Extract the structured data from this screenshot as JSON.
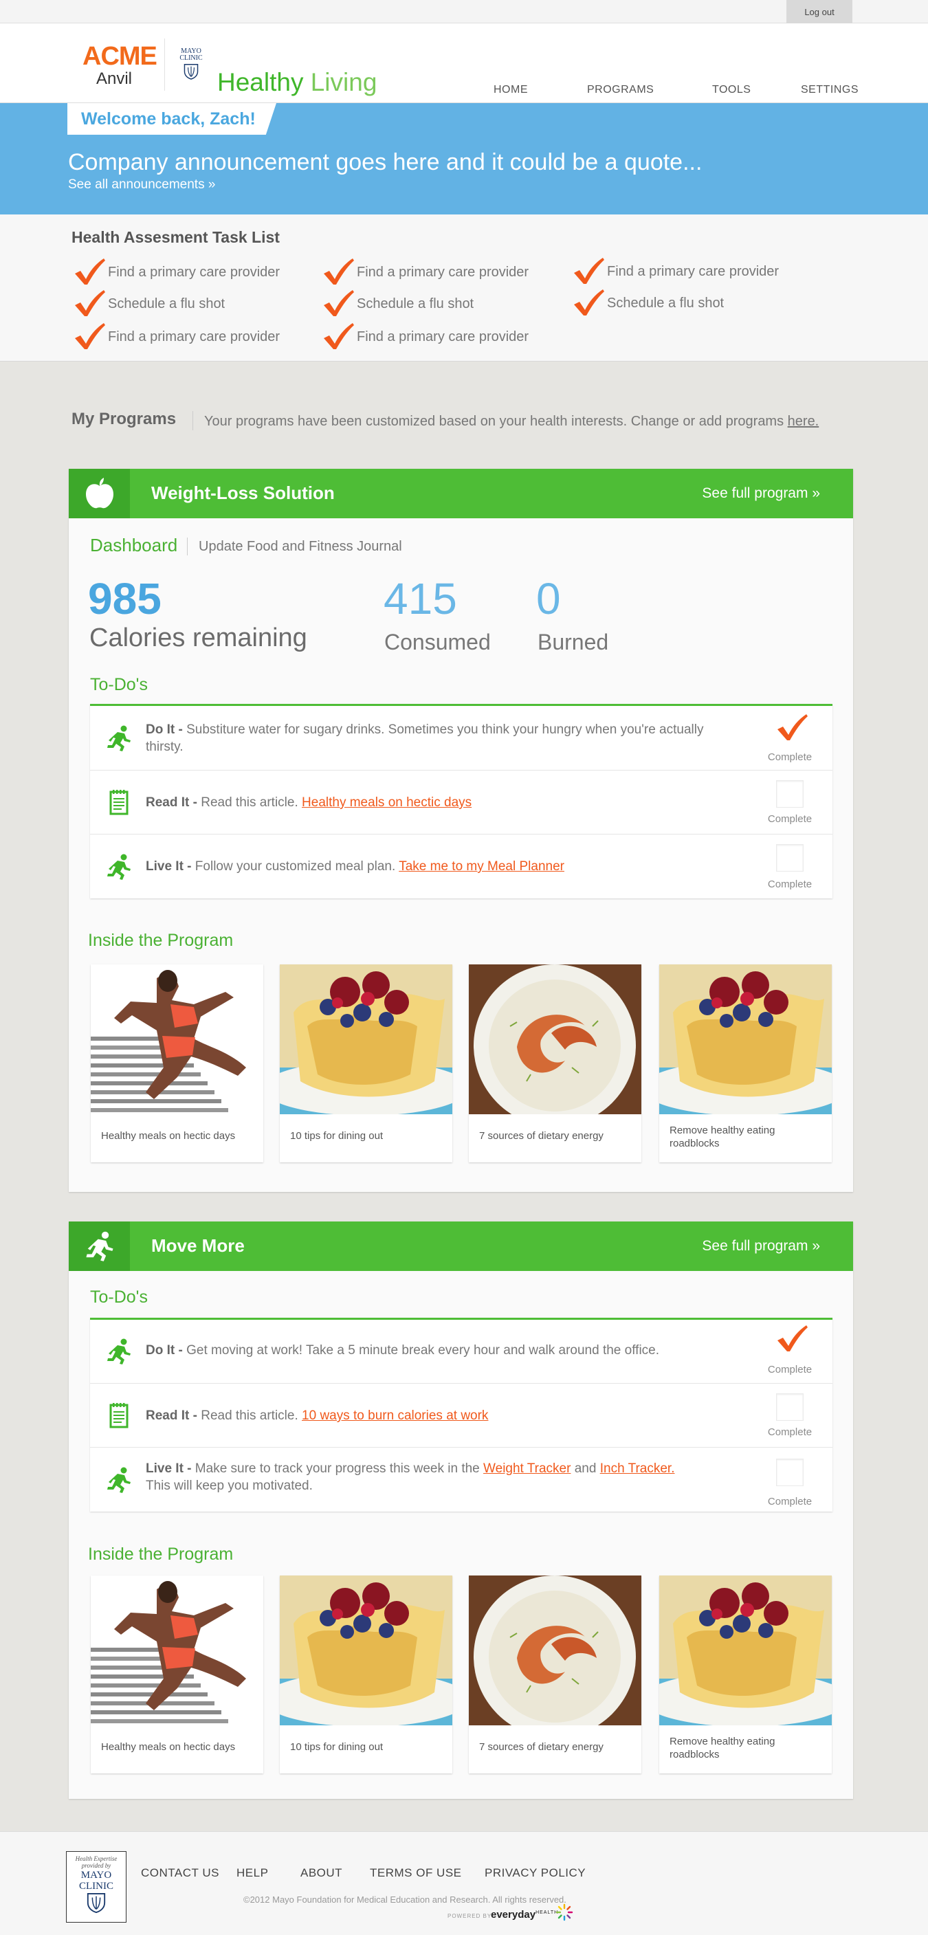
{
  "topbar": {
    "logout_label": "Log out"
  },
  "header": {
    "acme_top": "ACME",
    "acme_bottom": "Anvil",
    "mayo_mini": [
      "MAYO",
      "CLINIC"
    ],
    "brand_part1": "Healthy",
    "brand_part2": "Living",
    "nav": [
      "HOME",
      "PROGRAMS",
      "TOOLS",
      "SETTINGS"
    ]
  },
  "announcement": {
    "welcome": "Welcome back, Zach!",
    "text": "Company announcement goes here and it could be a quote...",
    "link": "See all announcements »"
  },
  "tasks": {
    "title": "Health Assesment Task List",
    "items": [
      "Find a primary care provider",
      "Schedule a flu shot",
      "Find a primary care provider",
      "Find a primary care provider",
      "Schedule a flu shot",
      "Find a primary care provider",
      "Find a primary care provider",
      "Schedule a flu shot"
    ]
  },
  "my_programs": {
    "title": "My Programs",
    "desc": "Your programs have been customized based on your health interests. Change or add programs ",
    "link": "here."
  },
  "program1": {
    "title": "Weight-Loss Solution",
    "link": "See full program »",
    "dashboard": "Dashboard",
    "journal_link": "Update Food and Fitness Journal",
    "calories_remaining": "985",
    "calories_remaining_label": "Calories remaining",
    "consumed": "415",
    "consumed_label": "Consumed",
    "burned": "0",
    "burned_label": "Burned",
    "todos_title": "To-Do's",
    "todos": [
      {
        "type": "Do It -",
        "text": "Substiture water for sugary drinks. Sometimes you think your hungry when you're actually thirsty.",
        "link": "",
        "status": "Complete",
        "done": true
      },
      {
        "type": "Read It -",
        "text": "Read this article. ",
        "link": "Healthy meals on hectic days",
        "status": "Complete",
        "done": false
      },
      {
        "type": "Live It -",
        "text": "Follow your customized meal plan. ",
        "link": "Take me to my Meal Planner",
        "status": "Complete",
        "done": false
      }
    ],
    "inside_title": "Inside the Program",
    "articles": [
      "Healthy meals on hectic days",
      "10 tips for dining out",
      "7 sources of dietary energy",
      "Remove healthy eating roadblocks"
    ]
  },
  "program2": {
    "title": "Move More",
    "link": "See full program »",
    "todos_title": "To-Do's",
    "todos": [
      {
        "type": "Do It -",
        "text": "Get moving at work! Take a 5 minute break every hour and walk around the office.",
        "status": "Complete",
        "done": true
      },
      {
        "type": "Read It -",
        "text": "Read this article. ",
        "link": "10 ways to burn calories at work",
        "status": "Complete",
        "done": false
      },
      {
        "type": "Live It -",
        "text1": "Make sure to track your progress this week in the ",
        "link1": "Weight Tracker",
        "text2": " and ",
        "link2": "Inch Tracker.",
        "text3": " This will keep you motivated.",
        "status": "Complete",
        "done": false
      }
    ],
    "inside_title": "Inside the Program",
    "articles": [
      "Healthy meals on hectic days",
      "10 tips for dining out",
      "7 sources of dietary energy",
      "Remove healthy eating roadblocks"
    ]
  },
  "footer": {
    "logo_small": [
      "Health Expertise",
      "provided by"
    ],
    "logo_mayo": [
      "MAYO",
      "CLINIC"
    ],
    "nav": [
      "CONTACT US",
      "HELP",
      "ABOUT",
      "TERMS OF USE",
      "PRIVACY POLICY"
    ],
    "copyright": "©2012 Mayo Foundation for Medical Education and Research. All rights reserved.",
    "powered": "POWERED BY",
    "everyday": "everyday",
    "everyday_health": "HEALTH"
  },
  "colors": {
    "green": "#4ebd36",
    "blue": "#62b2e4",
    "orange": "#f26a1b",
    "background": "#e6e5e1"
  },
  "icons": [
    "checkmark-icon",
    "apple-icon",
    "runner-icon",
    "notepad-icon",
    "mayo-shield-icon"
  ]
}
